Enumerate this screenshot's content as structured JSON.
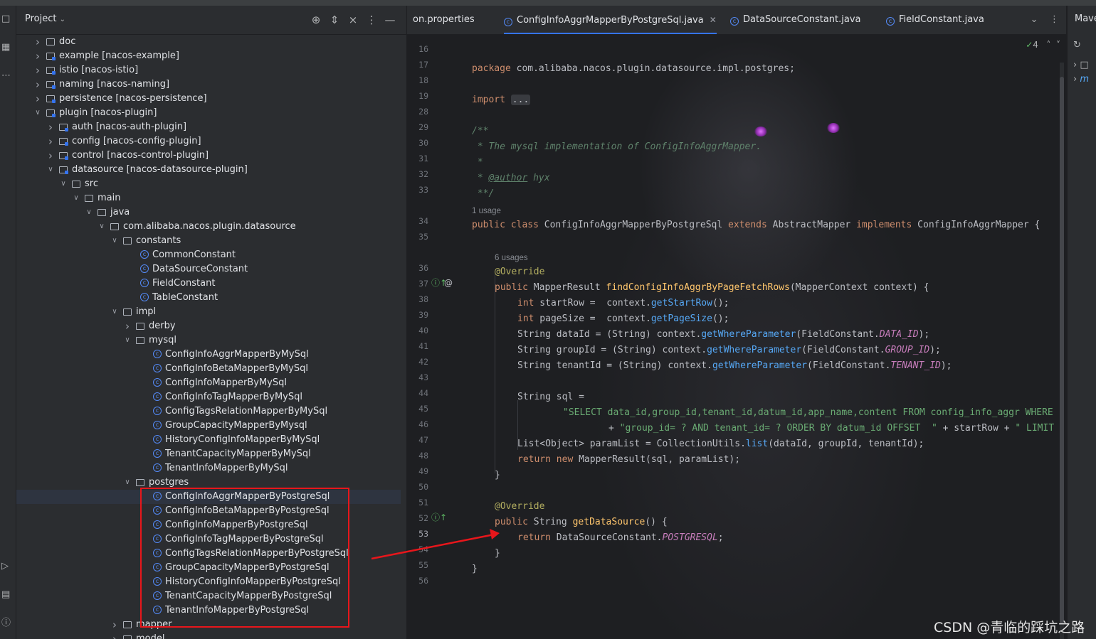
{
  "project_panel": {
    "title": "Project",
    "tree": [
      {
        "label": "doc",
        "module": ""
      },
      {
        "label": "example",
        "module": "[nacos-example]"
      },
      {
        "label": "istio",
        "module": "[nacos-istio]"
      },
      {
        "label": "naming",
        "module": "[nacos-naming]"
      },
      {
        "label": "persistence",
        "module": "[nacos-persistence]"
      },
      {
        "label": "plugin",
        "module": "[nacos-plugin]"
      },
      {
        "label": "auth",
        "module": "[nacos-auth-plugin]"
      },
      {
        "label": "config",
        "module": "[nacos-config-plugin]"
      },
      {
        "label": "control",
        "module": "[nacos-control-plugin]"
      },
      {
        "label": "datasource",
        "module": "[nacos-datasource-plugin]"
      },
      {
        "label": "src",
        "module": ""
      },
      {
        "label": "main",
        "module": ""
      },
      {
        "label": "java",
        "module": ""
      },
      {
        "label": "com.alibaba.nacos.plugin.datasource",
        "module": ""
      },
      {
        "label": "constants",
        "module": ""
      },
      {
        "label": "CommonConstant",
        "module": ""
      },
      {
        "label": "DataSourceConstant",
        "module": ""
      },
      {
        "label": "FieldConstant",
        "module": ""
      },
      {
        "label": "TableConstant",
        "module": ""
      },
      {
        "label": "impl",
        "module": ""
      },
      {
        "label": "derby",
        "module": ""
      },
      {
        "label": "mysql",
        "module": ""
      },
      {
        "label": "ConfigInfoAggrMapperByMySql",
        "module": ""
      },
      {
        "label": "ConfigInfoBetaMapperByMySql",
        "module": ""
      },
      {
        "label": "ConfigInfoMapperByMySql",
        "module": ""
      },
      {
        "label": "ConfigInfoTagMapperByMySql",
        "module": ""
      },
      {
        "label": "ConfigTagsRelationMapperByMySql",
        "module": ""
      },
      {
        "label": "GroupCapacityMapperByMysql",
        "module": ""
      },
      {
        "label": "HistoryConfigInfoMapperByMySql",
        "module": ""
      },
      {
        "label": "TenantCapacityMapperByMySql",
        "module": ""
      },
      {
        "label": "TenantInfoMapperByMySql",
        "module": ""
      },
      {
        "label": "postgres",
        "module": ""
      },
      {
        "label": "ConfigInfoAggrMapperByPostgreSql",
        "module": ""
      },
      {
        "label": "ConfigInfoBetaMapperByPostgreSql",
        "module": ""
      },
      {
        "label": "ConfigInfoMapperByPostgreSql",
        "module": ""
      },
      {
        "label": "ConfigInfoTagMapperByPostgreSql",
        "module": ""
      },
      {
        "label": "ConfigTagsRelationMapperByPostgreSql",
        "module": ""
      },
      {
        "label": "GroupCapacityMapperByPostgreSql",
        "module": ""
      },
      {
        "label": "HistoryConfigInfoMapperByPostgreSql",
        "module": ""
      },
      {
        "label": "TenantCapacityMapperByPostgreSql",
        "module": ""
      },
      {
        "label": "TenantInfoMapperByPostgreSql",
        "module": ""
      },
      {
        "label": "mapper",
        "module": ""
      },
      {
        "label": "model",
        "module": ""
      }
    ]
  },
  "editor": {
    "tabs": [
      {
        "label": "on.properties"
      },
      {
        "label": "ConfigInfoAggrMapperByPostgreSql.java"
      },
      {
        "label": "DataSourceConstant.java"
      },
      {
        "label": "FieldConstant.java"
      }
    ],
    "inspection_count": "4",
    "line_numbers": [
      "16",
      "17",
      "18",
      "19",
      "28",
      "29",
      "30",
      "31",
      "32",
      "33",
      "34",
      "35",
      "36",
      "37",
      "38",
      "39",
      "40",
      "41",
      "42",
      "43",
      "44",
      "45",
      "46",
      "47",
      "48",
      "49",
      "50",
      "51",
      "52",
      "53",
      "54",
      "55",
      "56"
    ],
    "hints": {
      "usage_1": "1 usage",
      "usage_6": "6 usages"
    },
    "code": {
      "l17_kw": "package",
      "l17_rest": " com.alibaba.nacos.plugin.datasource.impl.postgres;",
      "l19_kw": "import",
      "l19_rest": "...",
      "l29": "/**",
      "l30": " * The mysql implementation of ConfigInfoAggrMapper.",
      "l31": " *",
      "l32_a": " * ",
      "l32_tag": "@author",
      "l32_b": " hyx",
      "l33": " **/",
      "l34_kw1": "public class",
      "l34_name": " ConfigInfoAggrMapperByPostgreSql ",
      "l34_kw2": "extends",
      "l34_mid": " AbstractMapper ",
      "l34_kw3": "implements",
      "l34_end": " ConfigInfoAggrMapper {",
      "l36": "@Override",
      "l37_kw": "public",
      "l37_type": " MapperResult ",
      "l37_fn": "findConfigInfoAggrByPageFetchRows",
      "l37_end": "(MapperContext context) {",
      "l38_kw": "int",
      "l38_a": " startRow =  context.",
      "l38_fn": "getStartRow",
      "l38_end": "();",
      "l39_kw": "int",
      "l39_a": " pageSize =  context.",
      "l39_fn": "getPageSize",
      "l39_end": "();",
      "l40_a": "String dataId = (String) context.",
      "l40_fn": "getWhereParameter",
      "l40_b": "(FieldConstant.",
      "l40_c": "DATA_ID",
      "l40_d": ");",
      "l41_a": "String groupId = (String) context.",
      "l41_fn": "getWhereParameter",
      "l41_b": "(FieldConstant.",
      "l41_c": "GROUP_ID",
      "l41_d": ");",
      "l42_a": "String tenantId = (String) context.",
      "l42_fn": "getWhereParameter",
      "l42_b": "(FieldConstant.",
      "l42_c": "TENANT_ID",
      "l42_d": ");",
      "l44": "String sql =",
      "l45": "\"SELECT data_id,group_id,tenant_id,datum_id,app_name,content FROM config_info_aggr WHERE",
      "l46_a": "+ ",
      "l46_s": "\"group_id= ? AND tenant_id= ? ORDER BY datum_id OFFSET  \"",
      "l46_b": " + startRow + ",
      "l46_s2": "\" LIMIT",
      "l47_a": "List<Object> paramList = CollectionUtils.",
      "l47_fn": "list",
      "l47_b": "(dataId, groupId, tenantId);",
      "l48_kw": "return new",
      "l48_b": " MapperResult(sql, paramList);",
      "l49": "}",
      "l51": "@Override",
      "l52_kw": "public",
      "l52_type": " String ",
      "l52_fn": "getDataSource",
      "l52_end": "() {",
      "l53_kw": "return",
      "l53_a": " DataSourceConstant.",
      "l53_c": "POSTGRESQL",
      "l53_d": ";",
      "l54": "}",
      "l55": "}"
    }
  },
  "right_panel": {
    "title": "Mave",
    "item": "m"
  },
  "watermark": "CSDN @青临的踩坑之路",
  "colors": {
    "highlight_box": "#e8161b",
    "accent": "#3574f0"
  }
}
